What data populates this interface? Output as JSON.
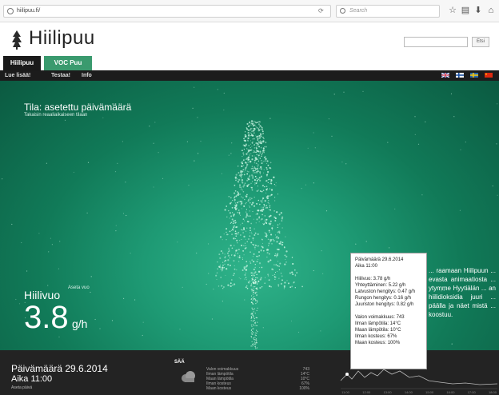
{
  "browser": {
    "url": "hiilipuu.fi/",
    "search_placeholder": "Search",
    "reload_icon": "reload-icon",
    "toolbar_icons": [
      "star-icon",
      "bookmark-list-icon",
      "download-icon",
      "home-icon"
    ]
  },
  "site": {
    "logo_text": "Hiilipuu",
    "search_button": "Etsi"
  },
  "tabs": [
    {
      "label": "Hiilipuu",
      "active": true
    },
    {
      "label": "VOC Puu",
      "active": false
    }
  ],
  "nav": {
    "items": [
      "Lue lisää!",
      "Testaa!",
      "Info"
    ],
    "languages": [
      "en",
      "fi",
      "sv",
      "zh"
    ]
  },
  "viz": {
    "state_title": "Tila: asetettu päivämäärä",
    "state_sub": "Takaisin reaaliaikaiseen tilaan",
    "hiilivuo_label": "Hiilivuo",
    "hiilivuo_set": "Aseta vuo",
    "hiilivuo_value": "3.8",
    "hiilivuo_unit": "g/h",
    "description": "... raamaan Hiilipuun ... evasta animaatiosta ... ytymme Hyytiälän ... an hiilidioksidia juuri ... päälla ja näet mistä ... koostuu."
  },
  "tooltip": {
    "date": "Päivämäärä 29.6.2014",
    "time": "Aika 11:00",
    "fluxes": [
      "Hiilivuo: 3.78 g/h",
      "Yhteyttäminen: 5.22 g/h",
      "Latvuston hengitys: 0.47 g/h",
      "Rungon hengitys: 0.16 g/h",
      "Juuriston hengitys: 0.82 g/h"
    ],
    "conditions": [
      "Valon voimakkuus: 743",
      "Ilman lämpötila: 14°C",
      "Maan lämpötila: 10°C",
      "Ilman kosteus: 67%",
      "Maan kosteus: 100%"
    ]
  },
  "bottom": {
    "date": "Päivämäärä 29.6.2014",
    "time": "Aika 11:00",
    "set_date": "Aseta päivä",
    "weather_title": "SÄÄ",
    "weather_icon": "cloud-icon",
    "weather_rows": [
      {
        "label": "Valon voimakkuus",
        "value": "743"
      },
      {
        "label": "Ilman lämpötila",
        "value": "14°C"
      },
      {
        "label": "Maan lämpötila",
        "value": "10°C"
      },
      {
        "label": "Ilman kosteus",
        "value": "67%"
      },
      {
        "label": "Maan kosteus",
        "value": "100%"
      }
    ],
    "chart_tick_labels": [
      "11:00",
      "12:00",
      "13:00",
      "14:00",
      "15:00",
      "16:00",
      "17:00",
      "18:00"
    ]
  },
  "colors": {
    "accent_green": "#3a9a6e",
    "viz_bg": "#1e9a74",
    "dark": "#1c1c1c"
  }
}
